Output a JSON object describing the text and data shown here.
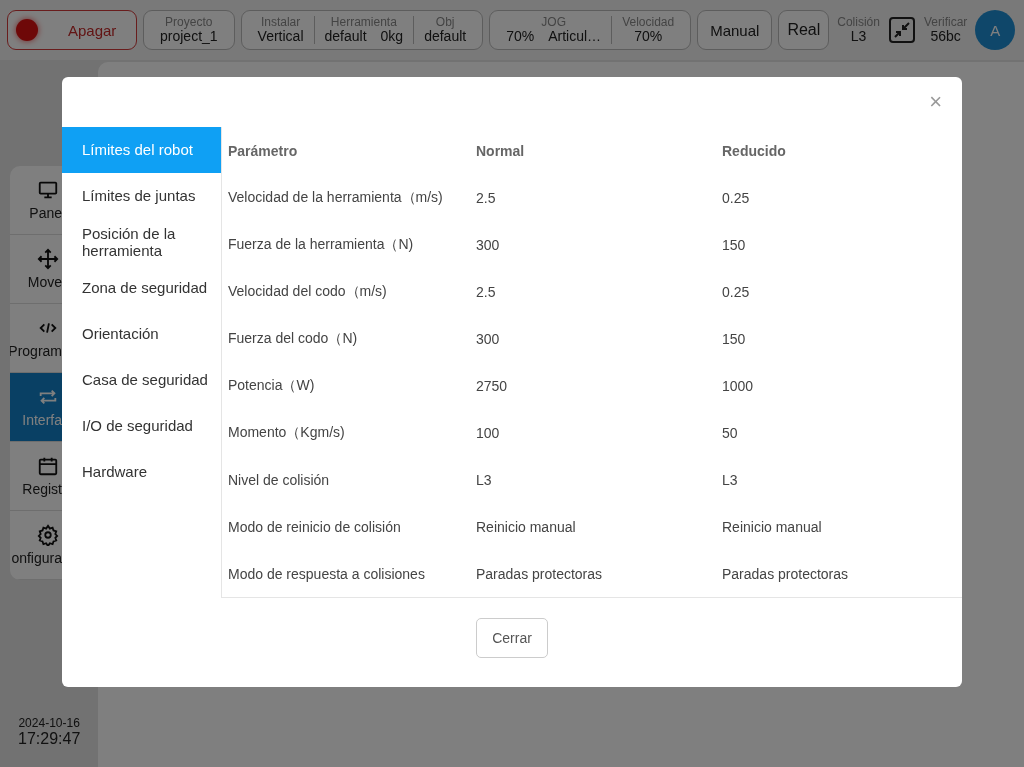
{
  "top_bar": {
    "power_button": {
      "label": "Apagar"
    },
    "groups": [
      [
        {
          "label": "Proyecto",
          "values": [
            "project_1"
          ]
        }
      ],
      [
        {
          "label": "Instalar",
          "values": [
            "Vertical"
          ]
        },
        {
          "label": "Herramienta",
          "values": [
            "default",
            "0kg"
          ]
        },
        {
          "label": "Obj",
          "values": [
            "default"
          ]
        }
      ],
      [
        {
          "label": "JOG",
          "values": [
            "70%",
            "Articul…"
          ]
        },
        {
          "label": "Velocidad",
          "values": [
            "70%"
          ]
        }
      ]
    ],
    "mode_buttons": [
      "Manual",
      "Real"
    ],
    "collision": {
      "label": "Colisión",
      "value": "L3"
    },
    "verify": {
      "label": "Verificar",
      "value": "56bc"
    },
    "avatar": "A"
  },
  "sidebar": {
    "items": [
      {
        "label": "Pane",
        "selected": false
      },
      {
        "label": "Move",
        "selected": false
      },
      {
        "label": "Program",
        "selected": false
      },
      {
        "label": "Interfa",
        "selected": true
      },
      {
        "label": "Regist",
        "selected": false
      },
      {
        "label": "onfigura",
        "selected": false
      }
    ],
    "date": "2024-10-16",
    "time": "17:29:47"
  },
  "dialog": {
    "close": "×",
    "nav": [
      {
        "label": "Límites del robot",
        "selected": true
      },
      {
        "label": "Límites de juntas",
        "selected": false
      },
      {
        "label": "Posición de la herramienta",
        "selected": false
      },
      {
        "label": "Zona de seguridad",
        "selected": false
      },
      {
        "label": "Orientación",
        "selected": false
      },
      {
        "label": "Casa de seguridad",
        "selected": false
      },
      {
        "label": "I/O de seguridad",
        "selected": false
      },
      {
        "label": "Hardware",
        "selected": false
      }
    ],
    "table": {
      "columns": [
        "Parámetro",
        "Normal",
        "Reducido"
      ],
      "rows": [
        [
          "Velocidad de la herramienta（m/s)",
          "2.5",
          "0.25"
        ],
        [
          "Fuerza de la herramienta（N)",
          "300",
          "150"
        ],
        [
          "Velocidad del codo（m/s)",
          "2.5",
          "0.25"
        ],
        [
          "Fuerza del codo（N)",
          "300",
          "150"
        ],
        [
          "Potencia（W)",
          "2750",
          "1000"
        ],
        [
          "Momento（Kgm/s)",
          "100",
          "50"
        ],
        [
          "Nivel de colisión",
          "L3",
          "L3"
        ],
        [
          "Modo de reinicio de colisión",
          "Reinicio manual",
          "Reinicio manual"
        ],
        [
          "Modo de respuesta a colisiones",
          "Paradas protectoras",
          "Paradas protectoras"
        ]
      ]
    },
    "button": "Cerrar"
  }
}
